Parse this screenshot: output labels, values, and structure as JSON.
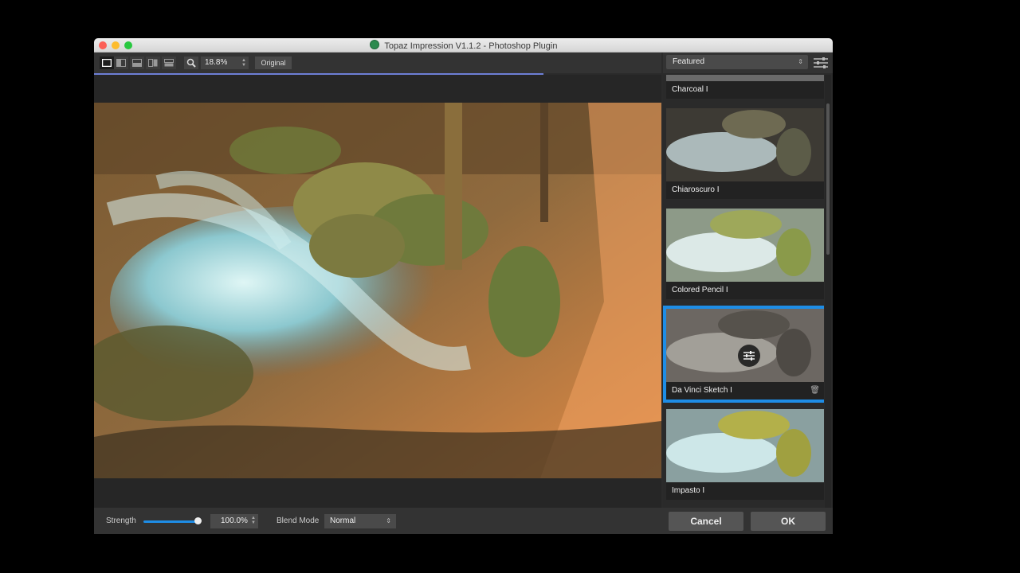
{
  "window": {
    "title": "Topaz Impression V1.1.2 - Photoshop Plugin"
  },
  "toolbar": {
    "zoom_value": "18.8%",
    "original_label": "Original"
  },
  "presets": {
    "category": "Featured",
    "items": [
      {
        "label": "Charcoal I"
      },
      {
        "label": "Chiaroscuro I"
      },
      {
        "label": "Colored Pencil I"
      },
      {
        "label": "Da Vinci Sketch I"
      },
      {
        "label": "Impasto I"
      }
    ]
  },
  "footer": {
    "strength_label": "Strength",
    "strength_value": "100.0%",
    "strength_level": 1.0,
    "blend_label": "Blend Mode",
    "blend_value": "Normal",
    "cancel_label": "Cancel",
    "ok_label": "OK"
  },
  "colors": {
    "accent": "#1e8de6",
    "progress": "#6d7fd6"
  }
}
